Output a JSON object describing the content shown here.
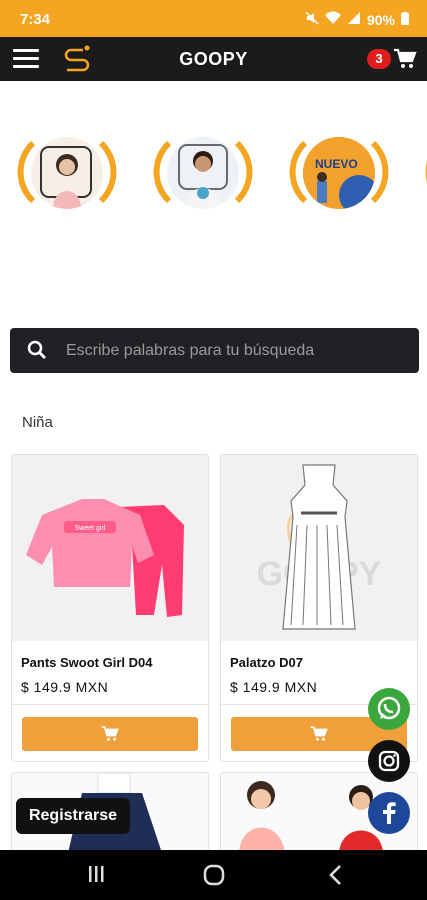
{
  "status_bar": {
    "time": "7:34",
    "battery": "90%",
    "icons": [
      "mute-icon",
      "wifi-icon",
      "signal-icon",
      "battery-icon"
    ]
  },
  "app_bar": {
    "title": "GOOPY",
    "cart_count": "3",
    "icons": [
      "menu-icon",
      "goopy-logo",
      "cart-icon"
    ]
  },
  "stories": {
    "items": [
      {
        "name": "story-girl",
        "overlay_text": ""
      },
      {
        "name": "story-boy",
        "overlay_text": ""
      },
      {
        "name": "story-nuevo",
        "overlay_text": "NUEVO"
      },
      {
        "name": "story-partial",
        "overlay_text": ""
      }
    ]
  },
  "search": {
    "placeholder": "Escribe palabras para tu búsqueda"
  },
  "section": {
    "title": "Niña"
  },
  "products": [
    {
      "name": "Pants Swoot Girl D04",
      "price": "$ 149.9 MXN",
      "shirt_text": "Sweet girl"
    },
    {
      "name": "Palatzo D07",
      "price": "$ 149.9 MXN",
      "watermark": "GOOPY"
    }
  ],
  "floating": {
    "whatsapp": "whatsapp-icon",
    "instagram": "instagram-icon",
    "facebook": "facebook-icon",
    "register_label": "Registrarse"
  },
  "colors": {
    "accent": "#f4a623",
    "button": "#efa03a",
    "dark": "#1b1b1b",
    "badge": "#e01d1d",
    "whatsapp": "#3aa63c",
    "facebook": "#1f4799"
  }
}
